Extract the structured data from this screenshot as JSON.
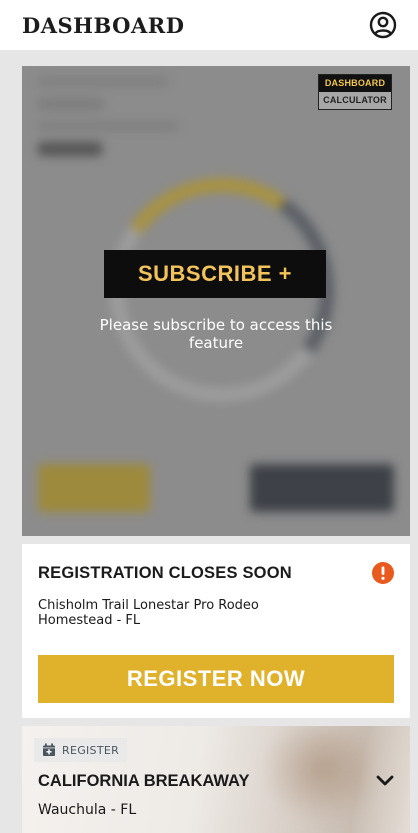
{
  "header": {
    "title": "DASHBOARD",
    "profile_icon": "user-circle-icon"
  },
  "locked_card": {
    "toggle": {
      "options": [
        "DASHBOARD",
        "CALCULATOR"
      ],
      "selected": "DASHBOARD"
    },
    "subscribe_label": "SUBSCRIBE +",
    "message": "Please subscribe to access this feature"
  },
  "registration": {
    "title": "REGISTRATION CLOSES SOON",
    "alert_icon": "alert-circle-icon",
    "event_name": "Chisholm Trail Lonestar Pro Rodeo",
    "event_location": "Homestead - FL",
    "button_label": "REGISTER NOW"
  },
  "event": {
    "chip_icon": "calendar-plus-icon",
    "chip_label": "REGISTER",
    "title": "CALIFORNIA BREAKAWAY",
    "location": "Wauchula - FL",
    "expand_icon": "chevron-down-icon"
  },
  "colors": {
    "accent_gold": "#e0b12a",
    "subscribe_text": "#f2c35a",
    "alert_orange": "#e85a1e"
  }
}
